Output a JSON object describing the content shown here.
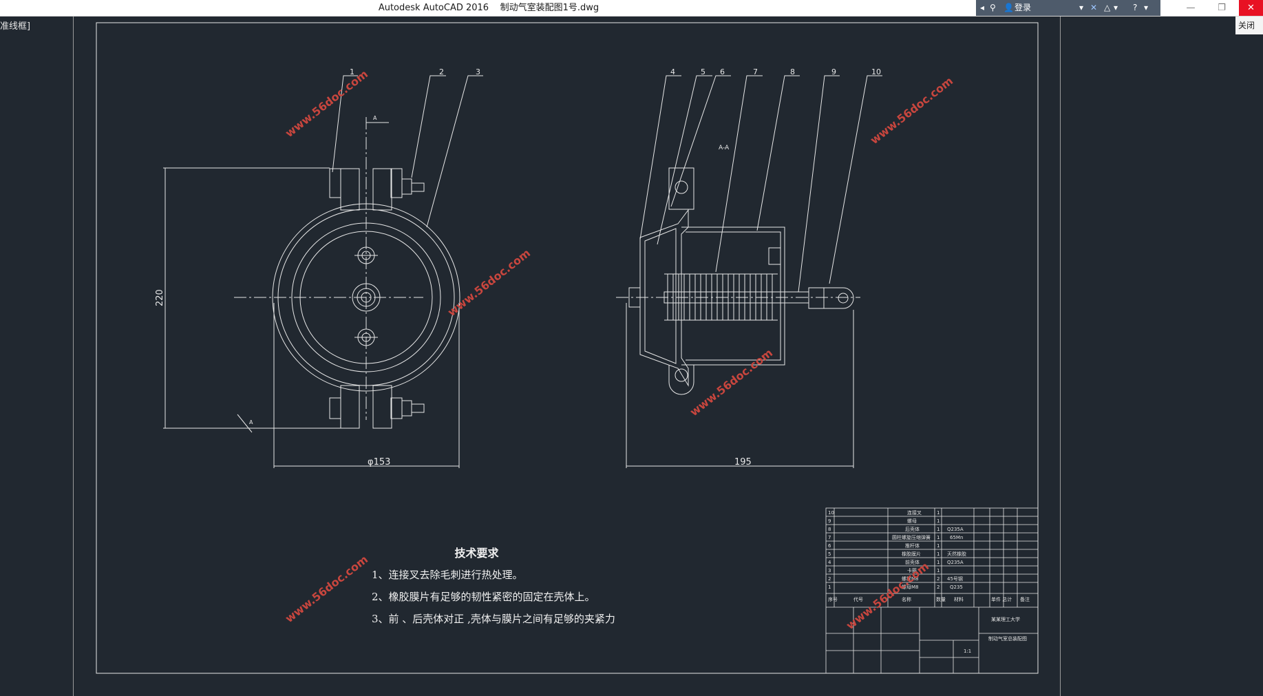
{
  "window": {
    "title": "Autodesk AutoCAD 2016    制动气室装配图1号.dwg",
    "login_label": "登录",
    "minimize": "—",
    "restore": "❐",
    "close": "✕",
    "side_tab": "关闭"
  },
  "viewport": {
    "label": "[-][俯视][二维线框]",
    "visible_label": "准线框]"
  },
  "drawing": {
    "left_view": {
      "part_numbers": [
        "1",
        "2",
        "3"
      ],
      "dim_height": "220",
      "dim_diameter": "φ153",
      "section_mark": "A"
    },
    "right_view": {
      "section_label": "A-A",
      "part_numbers": [
        "4",
        "5",
        "6",
        "7",
        "8",
        "9",
        "10"
      ],
      "dim_length": "195"
    }
  },
  "tech_requirements": {
    "title": "技术要求",
    "items": [
      "1、连接叉去除毛刺进行热处理。",
      "2、橡胶膜片有足够的韧性紧密的固定在壳体上。",
      "3、前 、后壳体对正 ,壳体与膜片之间有足够的夹紧力"
    ]
  },
  "title_block": {
    "drawing_name": "制动气室总装配图",
    "school": "某某理工大学",
    "scale": "1:1",
    "rows": [
      {
        "no": "10",
        "name": "连接叉",
        "qty": "1",
        "material": ""
      },
      {
        "no": "9",
        "name": "螺母",
        "qty": "1",
        "material": ""
      },
      {
        "no": "8",
        "name": "后壳体",
        "qty": "1",
        "material": "Q235A"
      },
      {
        "no": "7",
        "name": "圆柱螺旋压缩弹簧",
        "qty": "1",
        "material": "65Mn"
      },
      {
        "no": "6",
        "name": "推杆体",
        "qty": "1",
        "material": ""
      },
      {
        "no": "5",
        "name": "橡胶膜片",
        "qty": "1",
        "material": "天然橡胶"
      },
      {
        "no": "4",
        "name": "前壳体",
        "qty": "1",
        "material": "Q235A"
      },
      {
        "no": "3",
        "name": "卡箍",
        "qty": "1",
        "material": ""
      },
      {
        "no": "2",
        "name": "螺栓M8",
        "qty": "2",
        "material": "45号钢"
      },
      {
        "no": "1",
        "name": "螺母M8",
        "qty": "2",
        "material": "Q235"
      }
    ],
    "header": {
      "no": "序号",
      "code": "代号",
      "name": "名称",
      "qty": "数量",
      "material": "材料",
      "weight": "单件 总计",
      "note": "备注"
    }
  },
  "watermark": "www.56doc.com",
  "colors": {
    "background": "#212830",
    "line": "#e8e8e8",
    "watermark": "#c8463e",
    "close": "#e81123"
  }
}
